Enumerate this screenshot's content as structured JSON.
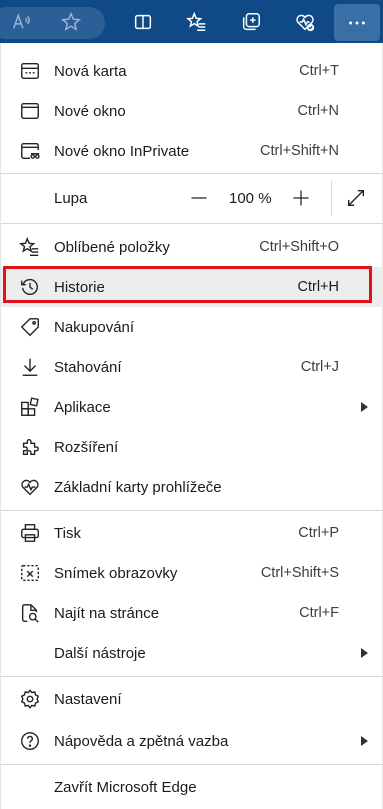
{
  "toolbar": {
    "buttons": [
      "read-aloud",
      "favorite-star",
      "split-screen",
      "favorites-list",
      "collections",
      "browser-essentials",
      "settings-more"
    ]
  },
  "menu": {
    "new_tab": {
      "label": "Nová karta",
      "shortcut": "Ctrl+T"
    },
    "new_window": {
      "label": "Nové okno",
      "shortcut": "Ctrl+N"
    },
    "new_inprivate": {
      "label": "Nové okno InPrivate",
      "shortcut": "Ctrl+Shift+N"
    },
    "zoom": {
      "label": "Lupa",
      "value": "100 %"
    },
    "favorites": {
      "label": "Oblíbené položky",
      "shortcut": "Ctrl+Shift+O"
    },
    "history": {
      "label": "Historie",
      "shortcut": "Ctrl+H"
    },
    "shopping": {
      "label": "Nakupování"
    },
    "downloads": {
      "label": "Stahování",
      "shortcut": "Ctrl+J"
    },
    "apps": {
      "label": "Aplikace"
    },
    "extensions": {
      "label": "Rozšíření"
    },
    "essentials": {
      "label": "Základní karty prohlížeče"
    },
    "print": {
      "label": "Tisk",
      "shortcut": "Ctrl+P"
    },
    "screenshot": {
      "label": "Snímek obrazovky",
      "shortcut": "Ctrl+Shift+S"
    },
    "find": {
      "label": "Najít na stránce",
      "shortcut": "Ctrl+F"
    },
    "more_tools": {
      "label": "Další nástroje"
    },
    "settings": {
      "label": "Nastavení"
    },
    "help": {
      "label": "Nápověda a zpětná vazba"
    },
    "close": {
      "label": "Zavřít Microsoft Edge"
    }
  },
  "colors": {
    "toolbar": "#0f4a86",
    "highlight_border": "#e3131c"
  }
}
